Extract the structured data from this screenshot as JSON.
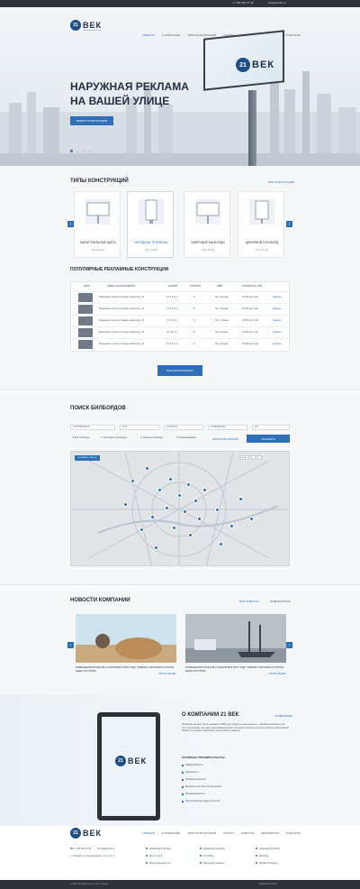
{
  "topbar": {
    "phone": "+7 495 440 37 90",
    "email": "info@21vek.ru"
  },
  "brand": {
    "number": "21",
    "name": "ВЕК",
    "tagline": "Рекламное агентство"
  },
  "nav": [
    {
      "label": "ГЛАВНАЯ"
    },
    {
      "label": "О КОМПАНИИ"
    },
    {
      "label": "ТИПЫ КОНСТРУКЦИЙ"
    },
    {
      "label": "УСЛУГИ"
    },
    {
      "label": "НОВОСТИ"
    },
    {
      "label": "ДОКУМЕНТЫ"
    },
    {
      "label": "КОНТАКТЫ"
    }
  ],
  "hero": {
    "title_line1": "НАРУЖНАЯ РЕКЛАМА",
    "title_line2": "НА ВАШЕЙ УЛИЦЕ",
    "button": "ВЫБОР КОНСТРУКЦИЙ",
    "billboard_sub": "Рекламное агентство"
  },
  "types": {
    "title": "ТИПЫ КОНСТРУКЦИЙ",
    "all_link": "ВСЕ КОНСТРУКЦИИ",
    "items": [
      {
        "name": "МАГИСТРАЛЬНЫЕ ЩИТЫ",
        "size": "3,0 x 6,0 м"
      },
      {
        "name": "НАРОДНЫЕ ТЕЛЕФОНЫ",
        "size": "1,2 x 1,8 м"
      },
      {
        "name": "ЦИФРОВЫЕ БИЛБОРДЫ",
        "size": "3,0 x 6,0 м"
      },
      {
        "name": "ЦИФРОВОЙ СИТИБОРД",
        "size": "2,7 x 3,7 м"
      }
    ]
  },
  "popular": {
    "title": "ПОПУЛЯРНЫЕ РЕКЛАМНЫЕ КОНСТРУКЦИИ",
    "headers": [
      "ФОТО",
      "АДРЕС РАСПОЛОЖЕНИЯ",
      "ФОРМАТ",
      "СТОРОНА",
      "СВЕТ",
      "СТОИМОСТЬ, РУБ",
      ""
    ],
    "rows": [
      {
        "address": "г. Балашиха, проспект Ленина, напротив д. 13",
        "format": "3,0 x 6,0 м",
        "side": "А",
        "light": "Нет / Аренда",
        "price": "32 000 руб / мес",
        "action": "Заказать"
      },
      {
        "address": "г. Балашиха, проспект Ленина, напротив д. 13",
        "format": "3,0 x 6,0 м",
        "side": "Б",
        "light": "Нет / Аренда",
        "price": "32 000 руб / мес",
        "action": "Заказать"
      },
      {
        "address": "г. Балашиха, проспект Ленина, напротив д. 13",
        "format": "3,0 x 6,0 м",
        "side": "А",
        "light": "Нет / Аренда",
        "price": "32 000 руб / мес",
        "action": "Заказать"
      },
      {
        "address": "г. Балашиха, проспект Ленина, напротив д. 13",
        "format": "3,0 x 6,0 м",
        "side": "Б",
        "light": "Нет / Аренда",
        "price": "32 000 руб / мес",
        "action": "Заказать"
      },
      {
        "address": "г. Балашиха, проспект Ленина, напротив д. 13",
        "format": "3,0 x 6,0 м",
        "side": "А",
        "light": "Нет / Аренда",
        "price": "32 000 руб / мес",
        "action": "Заказать"
      }
    ],
    "button": "ВСЕ КОНСТРУКЦИИ"
  },
  "search": {
    "title": "ПОИСК БИЛБОРДОВ",
    "selects": [
      "НАПРАВЛЕНИЕ",
      "ТИП",
      "СТОРОНА",
      "ОСВЕЩЕНИЕ",
      "ДО"
    ],
    "checks": [
      "Все билборды",
      "Свободные билборды",
      "Занятые билборды",
      "Резервирование"
    ],
    "reset": "СБРОСИТЬ ФИЛЬТР",
    "submit": "ПОКАЗАТЬ",
    "map_badge": "ПОКАЗАТЬ СПИСОК"
  },
  "news": {
    "title": "НОВОСТИ КОМПАНИИ",
    "all_link": "ВСЕ НОВОСТИ",
    "subscribe": "ПОДПИСАТЬСЯ",
    "items": [
      {
        "title": "ИЗМЕНЕНИЯ В ЗАКОНЕ О РЕКЛАМЕ В 2016 ГОДУ. ТОВАРЫ, РЕКЛАМА КОТОРЫХ НЕДО-ПУСТИМА.",
        "more": "ЧИТАТЬ ДАЛЕЕ"
      },
      {
        "title": "ИЗМЕНЕНИЯ В ЗАКОНЕ О РЕКЛАМЕ В 2016 ГОДУ. ТОВАРЫ, РЕКЛАМА КОТОРЫХ НЕДО-ПУСТИМА.",
        "more": "ЧИТАТЬ ДАЛЕЕ"
      }
    ]
  },
  "about": {
    "title": "О КОМПАНИИ 21 ВЕК",
    "more": "ПОДРОБНЕЕ",
    "text": "Компания «21 век» была основана в 1999 году. Сфера ее деятельности – наружная реклама и все, что с ней связано. За годы существования агентство заняло прочные позиции в Москве и Московской области, а сегодня продолжает свое активное развитие.",
    "principles_title": "ОСНОВНЫЕ ПРИНЦИПЫ РАБОТЫ",
    "principles": [
      "Эффективность",
      "Надежность",
      "Профессионализм",
      "Высокое качество обслуживания",
      "Инновационность",
      "Ориентация на нужды клиентов"
    ]
  },
  "footer": {
    "phone": "+7 495 440 37 90",
    "email": "info@21vek.ru",
    "address": "г. Москва, ул. Летниковская, д. 10, стр. 4",
    "links": [
      "Цифровой ситиборд",
      "Щиты 3 на 6",
      "Магистральный щит",
      "Цифровой ситиборд",
      "Ситиборд",
      "Народный телефон",
      "Цифровой билборд",
      "Билборд",
      "Дизайн билборда"
    ],
    "copyright": "© 2016 Рекламное агентство «21 век»",
    "dev": "Разработка сайта"
  }
}
